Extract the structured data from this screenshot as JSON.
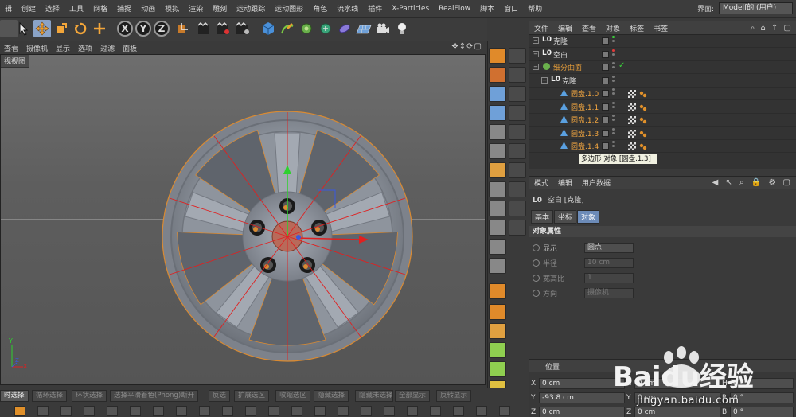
{
  "menubar": {
    "items": [
      "辑",
      "创建",
      "选择",
      "工具",
      "网格",
      "捕捉",
      "动画",
      "模拟",
      "渲染",
      "雕刻",
      "运动跟踪",
      "运动图形",
      "角色",
      "流水线",
      "插件",
      "X-Particles",
      "RealFlow",
      "脚本",
      "窗口",
      "帮助"
    ],
    "ui_label": "界面:",
    "layout": "Modelf的 (用户)"
  },
  "toolbar": {
    "axis_x": "X",
    "axis_y": "Y",
    "axis_z": "Z"
  },
  "viewport": {
    "menu": [
      "查看",
      "摄像机",
      "显示",
      "选项",
      "过滤",
      "面板"
    ],
    "nav_icons": "✥↕⟳▢",
    "title": "视视图",
    "axis_labels": {
      "y": "Y",
      "x": "X",
      "z": "Z"
    }
  },
  "object_manager": {
    "menu": [
      "文件",
      "编辑",
      "查看",
      "对象",
      "标签",
      "书签"
    ],
    "rows": [
      {
        "name": "克隆",
        "indent": 0,
        "icon": "L0"
      },
      {
        "name": "空白",
        "indent": 0,
        "icon": "L0"
      },
      {
        "name": "细分曲面",
        "indent": 0,
        "icon": "sds"
      },
      {
        "name": "克隆",
        "indent": 1,
        "icon": "L0"
      },
      {
        "name": "圆盘.1.0",
        "indent": 2,
        "icon": "poly"
      },
      {
        "name": "圆盘.1.1",
        "indent": 2,
        "icon": "poly"
      },
      {
        "name": "圆盘.1.2",
        "indent": 2,
        "icon": "poly"
      },
      {
        "name": "圆盘.1.3",
        "indent": 2,
        "icon": "poly"
      },
      {
        "name": "圆盘.1.4",
        "indent": 2,
        "icon": "poly"
      }
    ],
    "tooltip": "多边形 对象 [圆盘.1.3]"
  },
  "attribute_manager": {
    "menu": [
      "模式",
      "编辑",
      "用户数据"
    ],
    "object_title": "空白 [克隆]",
    "tabs": [
      "基本",
      "坐标",
      "对象"
    ],
    "active_tab": "对象",
    "section": "对象属性",
    "props": [
      {
        "label": "显示",
        "value": "圆点",
        "enabled": true
      },
      {
        "label": "半径",
        "value": "10 cm",
        "enabled": false
      },
      {
        "label": "宽高比",
        "value": "1",
        "enabled": false
      },
      {
        "label": "方向",
        "value": "摄像机",
        "enabled": false
      }
    ]
  },
  "coordinates": {
    "title": "位置",
    "rows": [
      {
        "axis": "X",
        "value": "0 cm",
        "axis2": "X",
        "value2": "0 cm",
        "axis3": "H",
        "value3": "0 °"
      },
      {
        "axis": "Y",
        "value": "-93.8 cm",
        "axis2": "Y",
        "value2": "0 cm",
        "axis3": "P",
        "value3": "0 °"
      },
      {
        "axis": "Z",
        "value": "0 cm",
        "axis2": "Z",
        "value2": "0 cm",
        "axis3": "B",
        "value3": "0 °"
      }
    ]
  },
  "modebar": {
    "items": [
      "时选择",
      "循环选择",
      "环状选择",
      "选择平滑着色(Phong)断开",
      "反选",
      "扩展选区",
      "收缩选区",
      "隐藏选择",
      "隐藏未选择",
      "全部显示",
      "反转显示"
    ],
    "active": "时选择"
  },
  "watermark": {
    "brand": "Baidu经验",
    "url": "jingyan.baidu.com"
  },
  "colors": {
    "accent": "#f2a640",
    "selection_blue": "#6c8bb8",
    "rim_orange": "#d98a32"
  }
}
